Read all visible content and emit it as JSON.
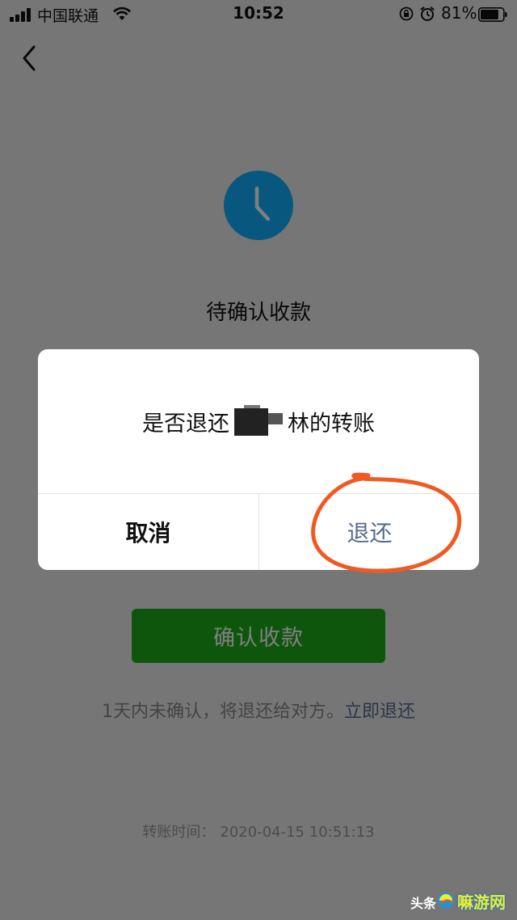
{
  "status_bar": {
    "carrier": "中国联通",
    "time": "10:52",
    "battery": "81%",
    "battery_level": 0.81,
    "signal_icon": "signal-bars-icon",
    "wifi_icon": "wifi-icon",
    "rotation_lock_icon": "rotation-lock-icon",
    "alarm_icon": "alarm-clock-icon"
  },
  "nav": {
    "back_icon": "chevron-left-icon"
  },
  "page": {
    "status_icon": "clock-icon",
    "title": "待确认收款",
    "confirm_button": "确认收款",
    "hint_text": "1天内未确认，将退还给对方。",
    "hint_link": "立即退还",
    "transfer_time_label": "转账时间：",
    "transfer_time_value": "2020-04-15 10:51:13"
  },
  "dialog": {
    "message_prefix": "是否退还",
    "message_suffix": "林的转账",
    "cancel_label": "取消",
    "return_label": "退还"
  },
  "watermark": {
    "left_text": "头条",
    "right_text": "嘛游网"
  },
  "colors": {
    "accent_green": "#1aad19",
    "link_blue": "#576b95",
    "clock_blue": "#10aeff",
    "annotation_orange": "#f05a22"
  }
}
